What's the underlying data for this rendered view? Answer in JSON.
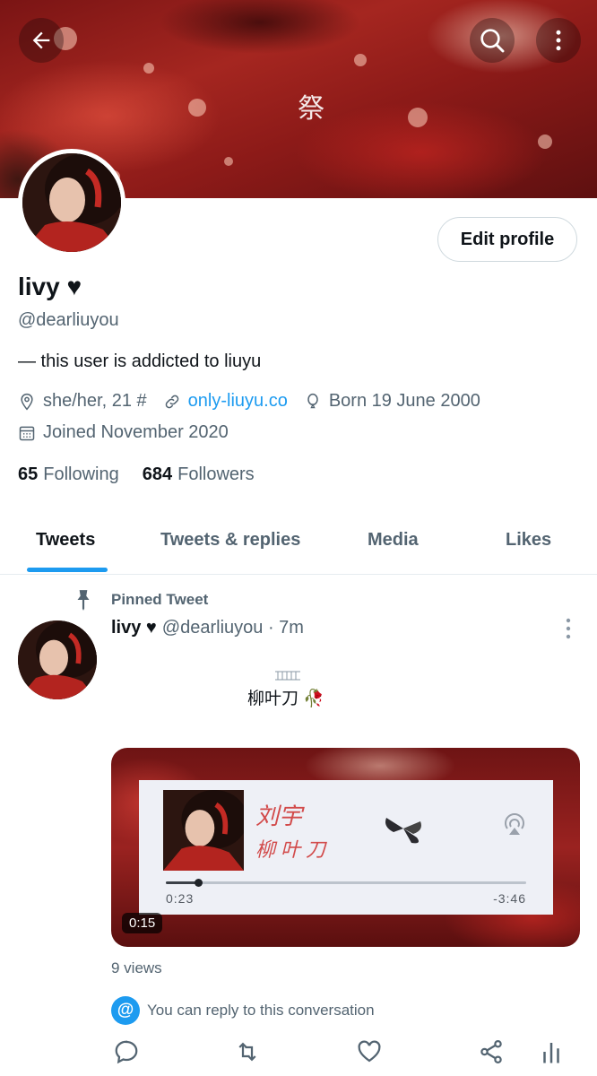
{
  "banner": {
    "glyph": "祭",
    "back_icon": "back-arrow-icon",
    "search_icon": "search-icon",
    "more_icon": "more-vertical-icon"
  },
  "profile": {
    "edit_label": "Edit profile",
    "name": "livy ♥",
    "handle": "@dearliuyou",
    "bio": "— this user is addicted to liuyu",
    "pronouns": "she/her, 21 #",
    "website": "only-liuyu.co",
    "birthday": "Born 19 June 2000",
    "joined": "Joined November 2020",
    "following_count": "65",
    "following_label": "Following",
    "followers_count": "684",
    "followers_label": "Followers"
  },
  "tabs": [
    {
      "label": "Tweets"
    },
    {
      "label": "Tweets & replies"
    },
    {
      "label": "Media"
    },
    {
      "label": "Likes"
    }
  ],
  "tweet": {
    "pinned_label": "Pinned Tweet",
    "author_name": "livy ♥",
    "author_handle": "@dearliuyou · 7m",
    "text": "柳叶刀 🥀",
    "media": {
      "artist": "刘宇",
      "title": "柳叶刀",
      "elapsed": "0:23",
      "remaining": "-3:46",
      "progress": 0.09,
      "video_time": "0:15"
    },
    "views": "9 views",
    "reply_note": "You can reply to this conversation",
    "reply_badge": "@"
  },
  "colors": {
    "accent": "#1d9bf0",
    "text": "#0f1419",
    "muted": "#536471"
  }
}
